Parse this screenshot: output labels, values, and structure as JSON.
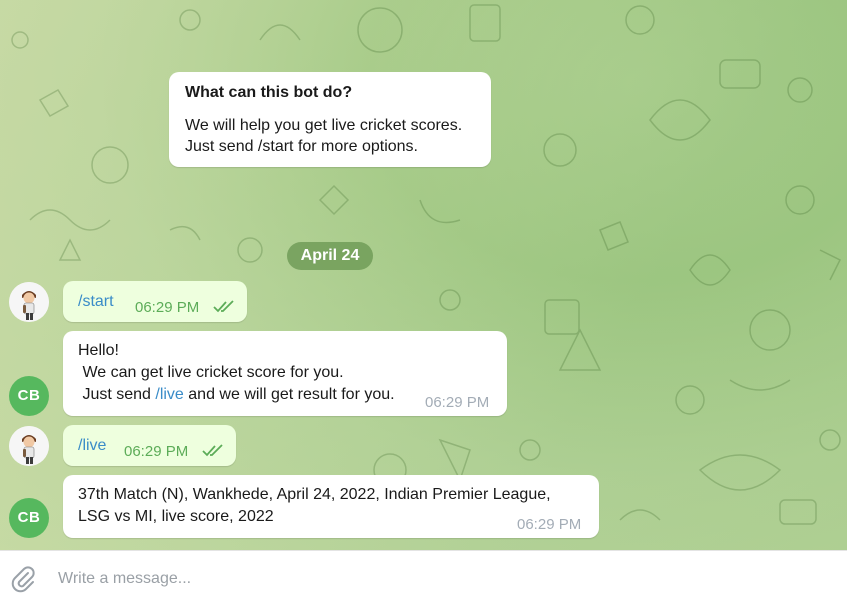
{
  "bot_info": {
    "title": "What can this bot do?",
    "line1": "We will help you get live cricket scores.",
    "line2": "Just send /start for more options."
  },
  "date_separator": "April 24",
  "messages": [
    {
      "direction": "outgoing",
      "text": "/start",
      "time": "06:29 PM",
      "status": "read"
    },
    {
      "direction": "incoming",
      "sender_initials": "CB",
      "line1": "Hello!",
      "line2": " We can get live cricket score for you.",
      "line3_prefix": " Just send ",
      "line3_cmd": "/live",
      "line3_suffix": " and we will get result for you.",
      "time": "06:29 PM"
    },
    {
      "direction": "outgoing",
      "text": "/live",
      "time": "06:29 PM",
      "status": "read"
    },
    {
      "direction": "incoming",
      "sender_initials": "CB",
      "line1": "37th Match (N), Wankhede, April 24, 2022, Indian Premier League,",
      "line2": "LSG vs MI, live score, 2022",
      "time": "06:29 PM"
    }
  ],
  "composer": {
    "placeholder": "Write a message..."
  },
  "icons": {
    "attach": "paperclip-icon",
    "read_status": "double-check-icon",
    "user_avatar": "cartoon-boy-avatar"
  },
  "colors": {
    "outgoing_bubble": "#eeffde",
    "incoming_bubble": "#ffffff",
    "bot_avatar": "#56b85e",
    "command_link": "#3a8cc8",
    "date_pill": "#6c9a54"
  }
}
